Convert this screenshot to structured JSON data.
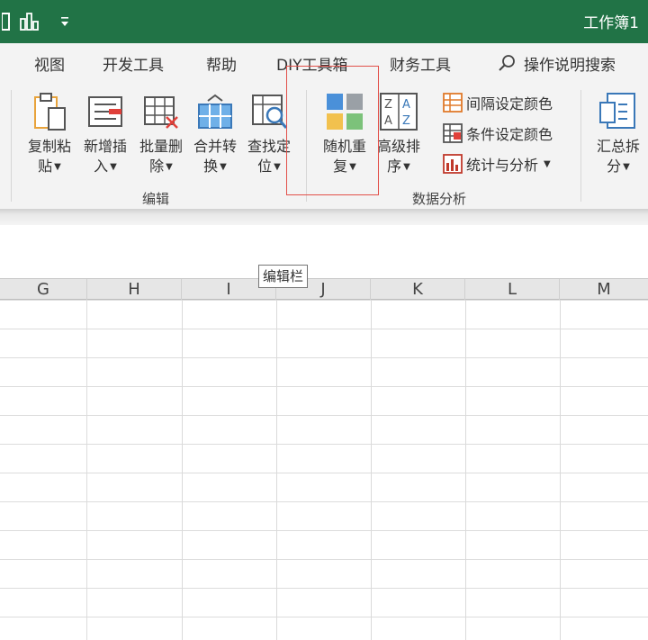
{
  "title_bar": {
    "quick_access": [
      {
        "name": "sidebar-icon"
      },
      {
        "name": "chart-icon"
      },
      {
        "name": "customize-dropdown-icon"
      }
    ],
    "document_title": "工作簿1",
    "color": "#217346"
  },
  "menu_tabs": [
    "视图",
    "开发工具",
    "帮助",
    "DIY工具箱",
    "财务工具"
  ],
  "search": {
    "label": "操作说明搜索"
  },
  "ribbon": {
    "edit_group": {
      "label": "编辑",
      "buttons": [
        {
          "line1": "复制粘",
          "line2": "贴"
        },
        {
          "line1": "新增插",
          "line2": "入"
        },
        {
          "line1": "批量删",
          "line2": "除"
        },
        {
          "line1": "合并转",
          "line2": "换"
        },
        {
          "line1": "查找定",
          "line2": "位"
        }
      ]
    },
    "data_group": {
      "label": "数据分析",
      "random": {
        "line1": "随机重",
        "line2": "复"
      },
      "sort": {
        "line1": "高级排",
        "line2": "序"
      },
      "small_buttons": [
        "间隔设定颜色",
        "条件设定颜色",
        "统计与分析"
      ]
    },
    "summary_button": {
      "line1": "汇总拆",
      "line2": "分"
    }
  },
  "tooltip": "编辑栏",
  "columns": [
    "G",
    "H",
    "I",
    "J",
    "K",
    "L",
    "M"
  ],
  "highlight_color": "#e2504a"
}
